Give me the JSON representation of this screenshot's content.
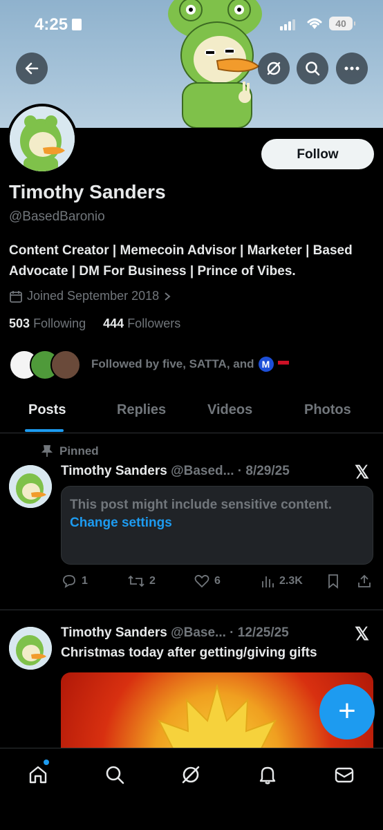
{
  "status_bar": {
    "time": "4:25",
    "battery": "40"
  },
  "profile": {
    "name": "Timothy Sanders",
    "handle": "@BasedBaronio",
    "bio": "Content Creator | Memecoin Advisor | Marketer | Based Advocate | DM For Business | Prince of Vibes.",
    "joined": "Joined September 2018",
    "following_count": "503",
    "following_label": "Following",
    "followers_count": "444",
    "followers_label": "Followers",
    "followed_by": "Followed by five, SATTA, and",
    "follow_button": "Follow"
  },
  "tabs": [
    "Posts",
    "Replies",
    "Videos",
    "Photos"
  ],
  "posts": [
    {
      "pinned_label": "Pinned",
      "author": "Timothy Sanders",
      "handle": "@Based...",
      "date": "· 8/29/25",
      "sensitive_text": "This post might include sensitive content.",
      "sensitive_link": "Change settings",
      "replies": "1",
      "reposts": "2",
      "likes": "6",
      "views": "2.3K"
    },
    {
      "author": "Timothy Sanders",
      "handle": "@Base...",
      "date": "· 12/25/25",
      "text": "Christmas today after getting/giving gifts"
    }
  ],
  "icons": {
    "back": "back-arrow-icon",
    "grok": "grok-icon",
    "search": "search-icon",
    "more": "more-icon",
    "x_logo": "x-logo-icon"
  },
  "colors": {
    "accent": "#1d9bf0",
    "background": "#000000",
    "muted": "#71767b"
  }
}
